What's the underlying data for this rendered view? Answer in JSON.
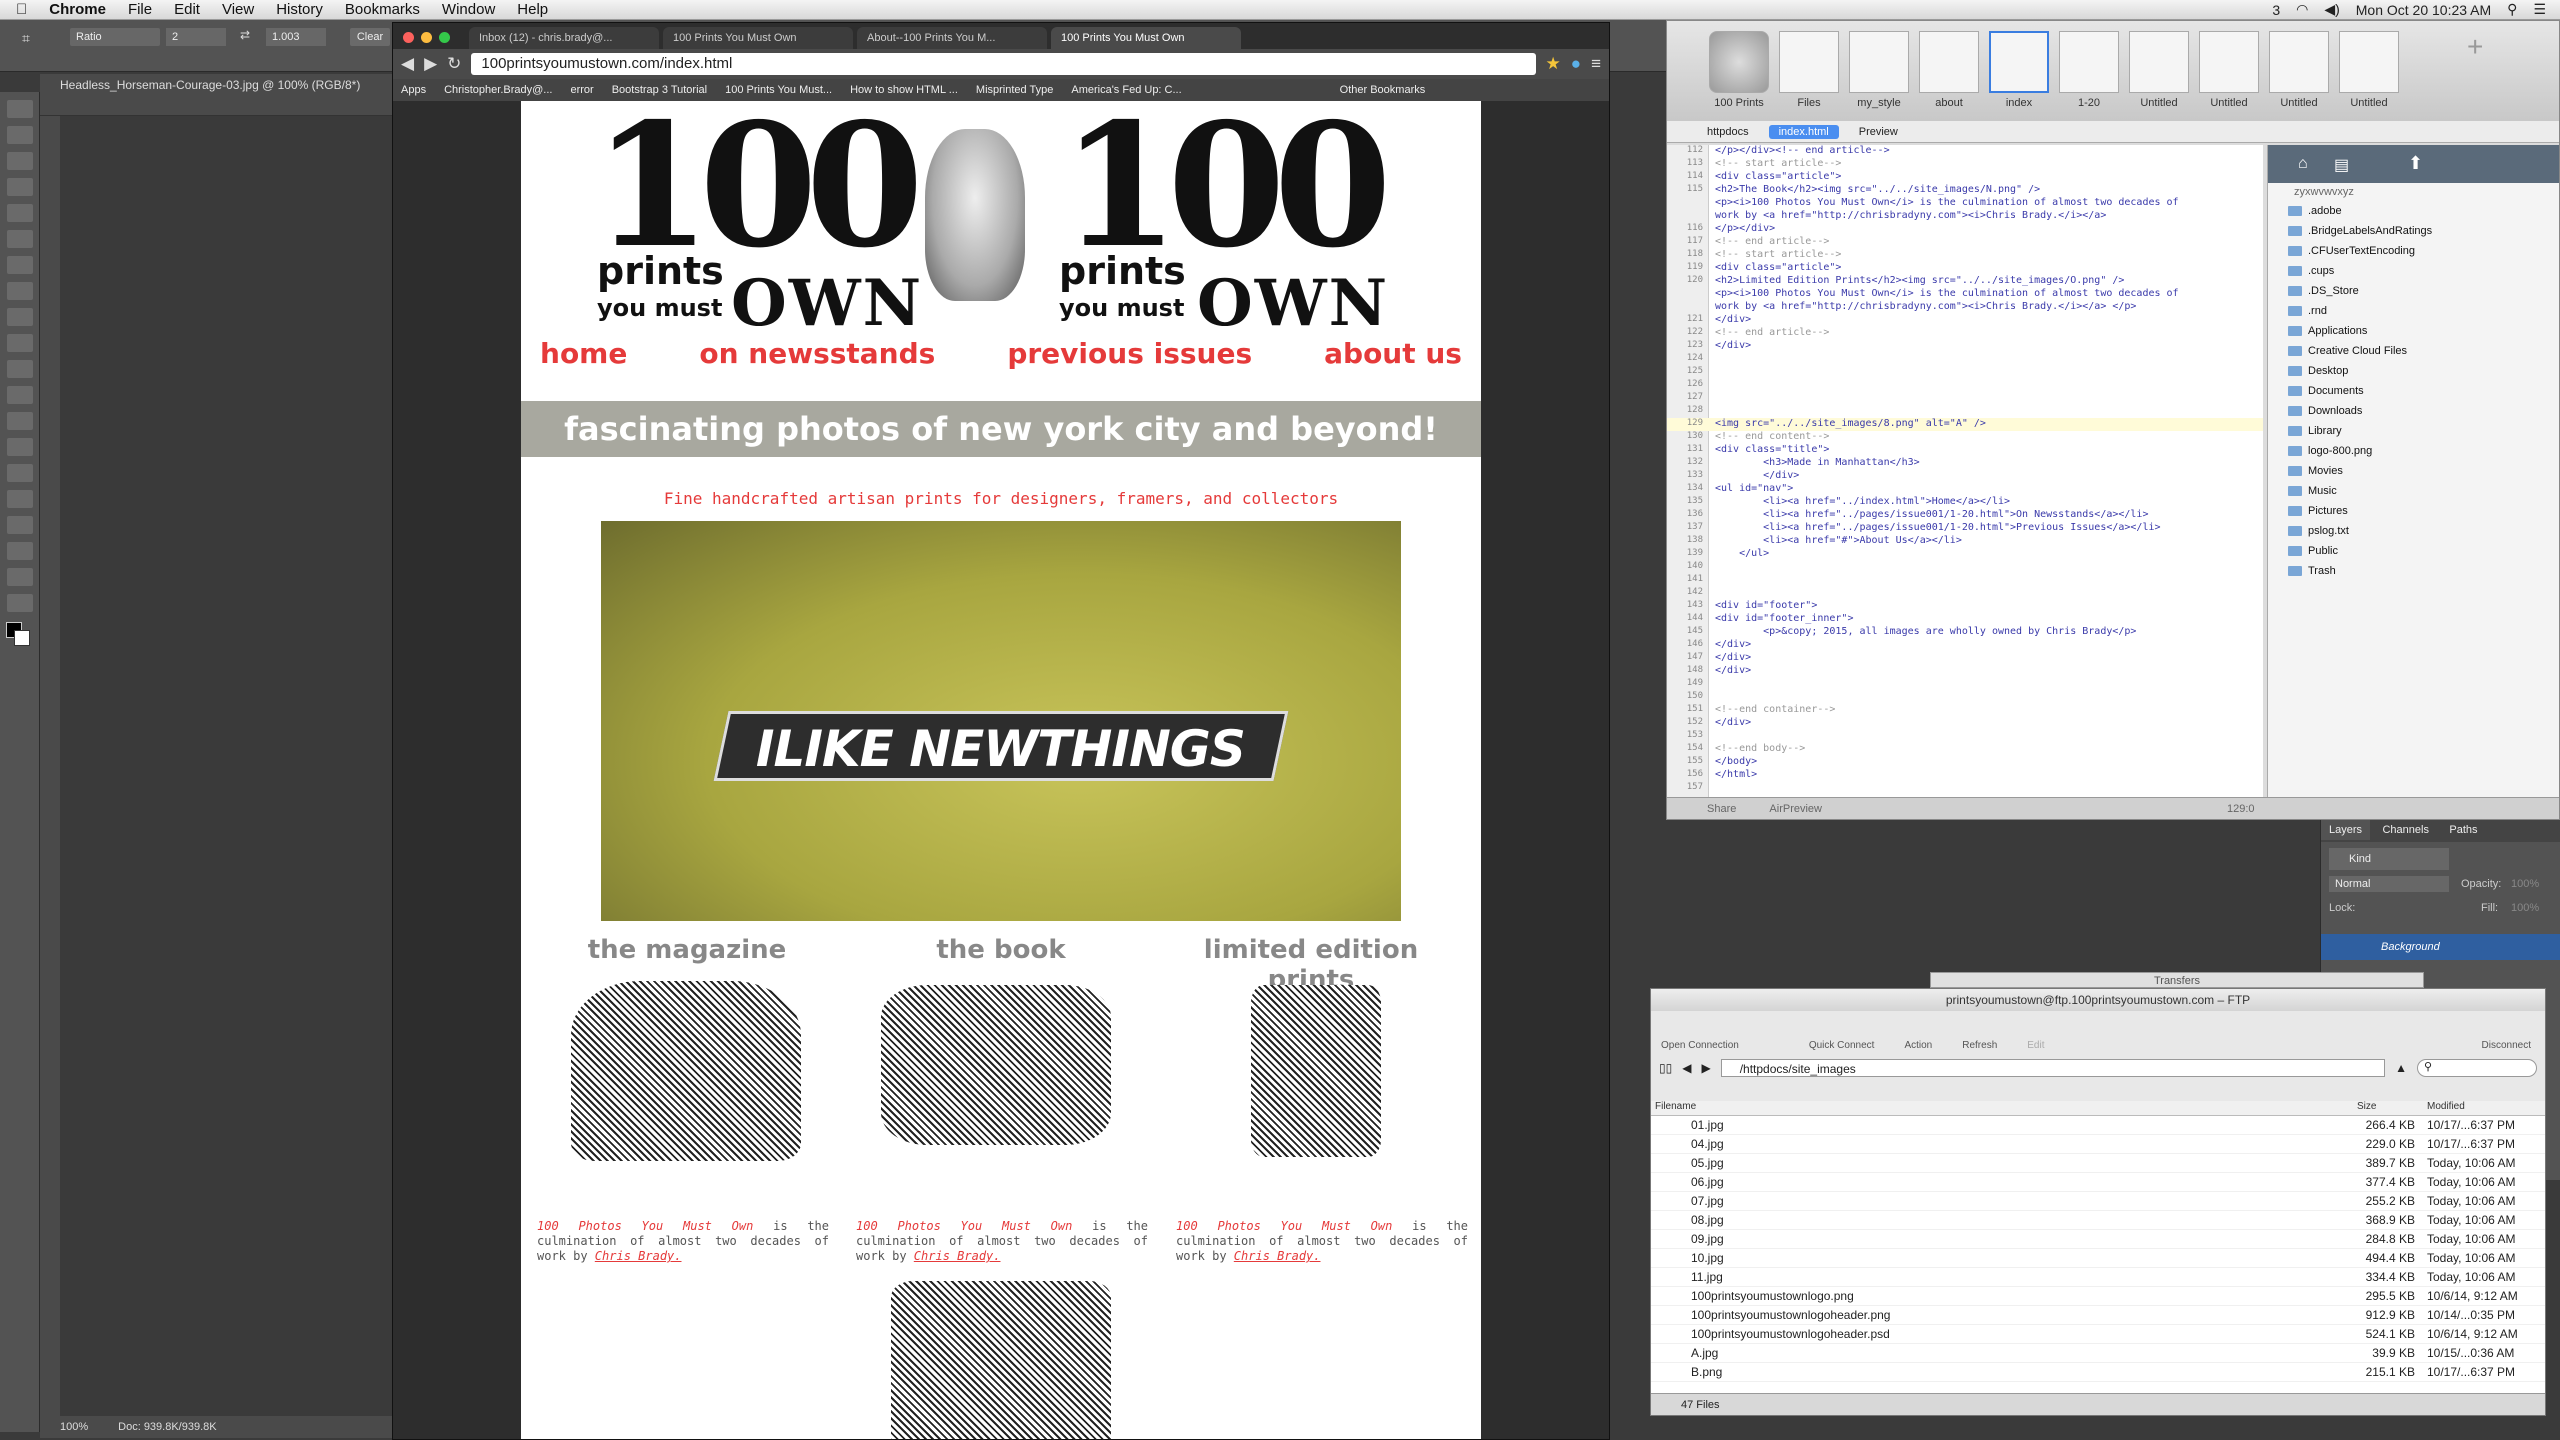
{
  "menubar": {
    "app": "Chrome",
    "items": [
      "File",
      "Edit",
      "View",
      "History",
      "Bookmarks",
      "Window",
      "Help"
    ],
    "clock": "Mon Oct 20  10:23 AM",
    "battery": "3"
  },
  "photoshop": {
    "doc_tab": "Headless_Horseman-Courage-03.jpg @ 100% (RGB/8*)",
    "opt_style": "Ratio",
    "opt_w": "2",
    "opt_h": "1.003",
    "opt_clear": "Clear",
    "zoom": "100%",
    "doc_size": "Doc: 939.8K/939.8K",
    "panel_tabs": [
      "Layers",
      "Channels",
      "Paths"
    ],
    "kind": "Kind",
    "blend": "Normal",
    "opacity_label": "Opacity:",
    "opacity": "100%",
    "lock": "Lock:",
    "fill_label": "Fill:",
    "fill": "100%",
    "layer": "Background"
  },
  "chrome": {
    "tabs": [
      "Inbox (12) - chris.brady@...",
      "100 Prints You Must Own",
      "About--100 Prints You M...",
      "100 Prints You Must Own"
    ],
    "url": "100printsyoumustown.com/index.html",
    "bookmarks": [
      "Apps",
      "Christopher.Brady@...",
      "error",
      "Bootstrap 3 Tutorial",
      "100 Prints You Must...",
      "How to show HTML ...",
      "Misprinted Type",
      "America's Fed Up: C...",
      "Other Bookmarks"
    ]
  },
  "site": {
    "logo_num": "100",
    "logo_prints": "prints",
    "logo_you": "you must",
    "logo_own": "OWN",
    "nav": [
      "home",
      "on newsstands",
      "previous issues",
      "about us"
    ],
    "banner": "fascinating photos of new york city and beyond!",
    "tagline": "Fine handcrafted artisan prints for designers, framers, and collectors",
    "hero_text": "ILIKE NEWTHINGS",
    "cols": [
      {
        "title": "the magazine",
        "em": "100 Photos You Must Own",
        "mid": " is the culmination of almost two decades of work by ",
        "author": "Chris Brady."
      },
      {
        "title": "the book",
        "em": "100 Photos You Must Own",
        "mid": " is the culmination of almost two decades of work by ",
        "author": "Chris Brady."
      },
      {
        "title": "limited edition prints",
        "em": "100 Photos You Must Own",
        "mid": " is the culmination of almost two decades of work by ",
        "author": "Chris Brady."
      }
    ]
  },
  "coda": {
    "sites": [
      {
        "label": "100 Prints"
      },
      {
        "label": "Files"
      },
      {
        "label": "my_style"
      },
      {
        "label": "about"
      },
      {
        "label": "index"
      },
      {
        "label": "1-20"
      },
      {
        "label": "Untitled"
      },
      {
        "label": "Untitled"
      },
      {
        "label": "Untitled"
      },
      {
        "label": "Untitled"
      }
    ],
    "path": [
      "httpdocs",
      "index.html",
      "Preview"
    ],
    "lines": [
      {
        "n": "112",
        "t": "</p></div><!-- end article-->",
        "c": false
      },
      {
        "n": "113",
        "t": "<!-- start article-->",
        "c": true
      },
      {
        "n": "114",
        "t": "<div class=\"article\">",
        "c": false
      },
      {
        "n": "115",
        "t": "<h2>The Book</h2><img src=\"../../site_images/N.png\" />",
        "c": false
      },
      {
        "n": "",
        "t": "<p><i>100 Photos You Must Own</i> is the culmination of almost two decades of",
        "c": false
      },
      {
        "n": "",
        "t": "work by <a href=\"http://chrisbradyny.com\"><i>Chris Brady.</i></a>",
        "c": false
      },
      {
        "n": "116",
        "t": "</p></div>",
        "c": false
      },
      {
        "n": "117",
        "t": "<!-- end article-->",
        "c": true
      },
      {
        "n": "118",
        "t": "<!-- start article-->",
        "c": true
      },
      {
        "n": "119",
        "t": "<div class=\"article\">",
        "c": false
      },
      {
        "n": "120",
        "t": "<h2>Limited Edition Prints</h2><img src=\"../../site_images/O.png\" />",
        "c": false
      },
      {
        "n": "",
        "t": "<p><i>100 Photos You Must Own</i> is the culmination of almost two decades of",
        "c": false
      },
      {
        "n": "",
        "t": "work by <a href=\"http://chrisbradyny.com\"><i>Chris Brady.</i></a> </p>",
        "c": false
      },
      {
        "n": "121",
        "t": "</div>",
        "c": false
      },
      {
        "n": "122",
        "t": "<!-- end article-->",
        "c": true
      },
      {
        "n": "123",
        "t": "</div>",
        "c": false
      },
      {
        "n": "124",
        "t": "",
        "c": false
      },
      {
        "n": "125",
        "t": "",
        "c": false
      },
      {
        "n": "126",
        "t": "",
        "c": false
      },
      {
        "n": "127",
        "t": "",
        "c": false
      },
      {
        "n": "128",
        "t": "",
        "c": false
      },
      {
        "n": "129",
        "t": "<img src=\"../../site_images/8.png\" alt=\"A\" />",
        "c": false
      },
      {
        "n": "130",
        "t": "<!-- end content-->",
        "c": true
      },
      {
        "n": "131",
        "t": "<div class=\"title\">",
        "c": false
      },
      {
        "n": "132",
        "t": "        <h3>Made in Manhattan</h3>",
        "c": false
      },
      {
        "n": "133",
        "t": "        </div>",
        "c": false
      },
      {
        "n": "134",
        "t": "<ul id=\"nav\">",
        "c": false
      },
      {
        "n": "135",
        "t": "        <li><a href=\"../index.html\">Home</a></li>",
        "c": false
      },
      {
        "n": "136",
        "t": "        <li><a href=\"../pages/issue001/1-20.html\">On Newsstands</a></li>",
        "c": false
      },
      {
        "n": "137",
        "t": "        <li><a href=\"../pages/issue001/1-20.html\">Previous Issues</a></li>",
        "c": false
      },
      {
        "n": "138",
        "t": "        <li><a href=\"#\">About Us</a></li>",
        "c": false
      },
      {
        "n": "139",
        "t": "    </ul>",
        "c": false
      },
      {
        "n": "140",
        "t": "",
        "c": false
      },
      {
        "n": "141",
        "t": "",
        "c": false
      },
      {
        "n": "142",
        "t": "",
        "c": false
      },
      {
        "n": "143",
        "t": "<div id=\"footer\">",
        "c": false
      },
      {
        "n": "144",
        "t": "<div id=\"footer_inner\">",
        "c": false
      },
      {
        "n": "145",
        "t": "        <p>&copy; 2015, all images are wholly owned by Chris Brady</p>",
        "c": false
      },
      {
        "n": "146",
        "t": "</div>",
        "c": false
      },
      {
        "n": "147",
        "t": "</div>",
        "c": false
      },
      {
        "n": "148",
        "t": "</div>",
        "c": false
      },
      {
        "n": "149",
        "t": "",
        "c": false
      },
      {
        "n": "150",
        "t": "",
        "c": false
      },
      {
        "n": "151",
        "t": "<!--end container-->",
        "c": true
      },
      {
        "n": "152",
        "t": "</div>",
        "c": false
      },
      {
        "n": "153",
        "t": "",
        "c": false
      },
      {
        "n": "154",
        "t": "<!--end body-->",
        "c": true
      },
      {
        "n": "155",
        "t": "</body>",
        "c": false
      },
      {
        "n": "156",
        "t": "</html>",
        "c": false
      },
      {
        "n": "157",
        "t": "",
        "c": false
      }
    ],
    "files_loc": "zyxwvwvxyz",
    "files": [
      ".adobe",
      ".BridgeLabelsAndRatings",
      ".CFUserTextEncoding",
      ".cups",
      ".DS_Store",
      ".rnd",
      "Applications",
      "Creative Cloud Files",
      "Desktop",
      "Documents",
      "Downloads",
      "Library",
      "logo-800.png",
      "Movies",
      "Music",
      "Pictures",
      "pslog.txt",
      "Public",
      "Trash"
    ],
    "status_share": "Share",
    "status_airpreview": "AirPreview",
    "status_pos": "129:0"
  },
  "ftp": {
    "title": "printsyoumustown@ftp.100printsyoumustown.com – FTP",
    "transfers": "Transfers",
    "tools": [
      "Open Connection",
      "Quick Connect",
      "Action",
      "Refresh",
      "Edit",
      "Disconnect"
    ],
    "path": "/httpdocs/site_images",
    "headers": [
      "Filename",
      "Size",
      "Modified"
    ],
    "rows": [
      [
        "01.jpg",
        "266.4 KB",
        "10/17/...6:37 PM"
      ],
      [
        "04.jpg",
        "229.0 KB",
        "10/17/...6:37 PM"
      ],
      [
        "05.jpg",
        "389.7 KB",
        "Today, 10:06 AM"
      ],
      [
        "06.jpg",
        "377.4 KB",
        "Today, 10:06 AM"
      ],
      [
        "07.jpg",
        "255.2 KB",
        "Today, 10:06 AM"
      ],
      [
        "08.jpg",
        "368.9 KB",
        "Today, 10:06 AM"
      ],
      [
        "09.jpg",
        "284.8 KB",
        "Today, 10:06 AM"
      ],
      [
        "10.jpg",
        "494.4 KB",
        "Today, 10:06 AM"
      ],
      [
        "11.jpg",
        "334.4 KB",
        "Today, 10:06 AM"
      ],
      [
        "100printsyoumustownlogo.png",
        "295.5 KB",
        "10/6/14, 9:12 AM"
      ],
      [
        "100printsyoumustownlogoheader.png",
        "912.9 KB",
        "10/14/...0:35 PM"
      ],
      [
        "100printsyoumustownlogoheader.psd",
        "524.1 KB",
        "10/6/14, 9:12 AM"
      ],
      [
        "A.jpg",
        "39.9 KB",
        "10/15/...0:36 AM"
      ],
      [
        "B.png",
        "215.1 KB",
        "10/17/...6:37 PM"
      ]
    ],
    "count": "47 Files"
  }
}
